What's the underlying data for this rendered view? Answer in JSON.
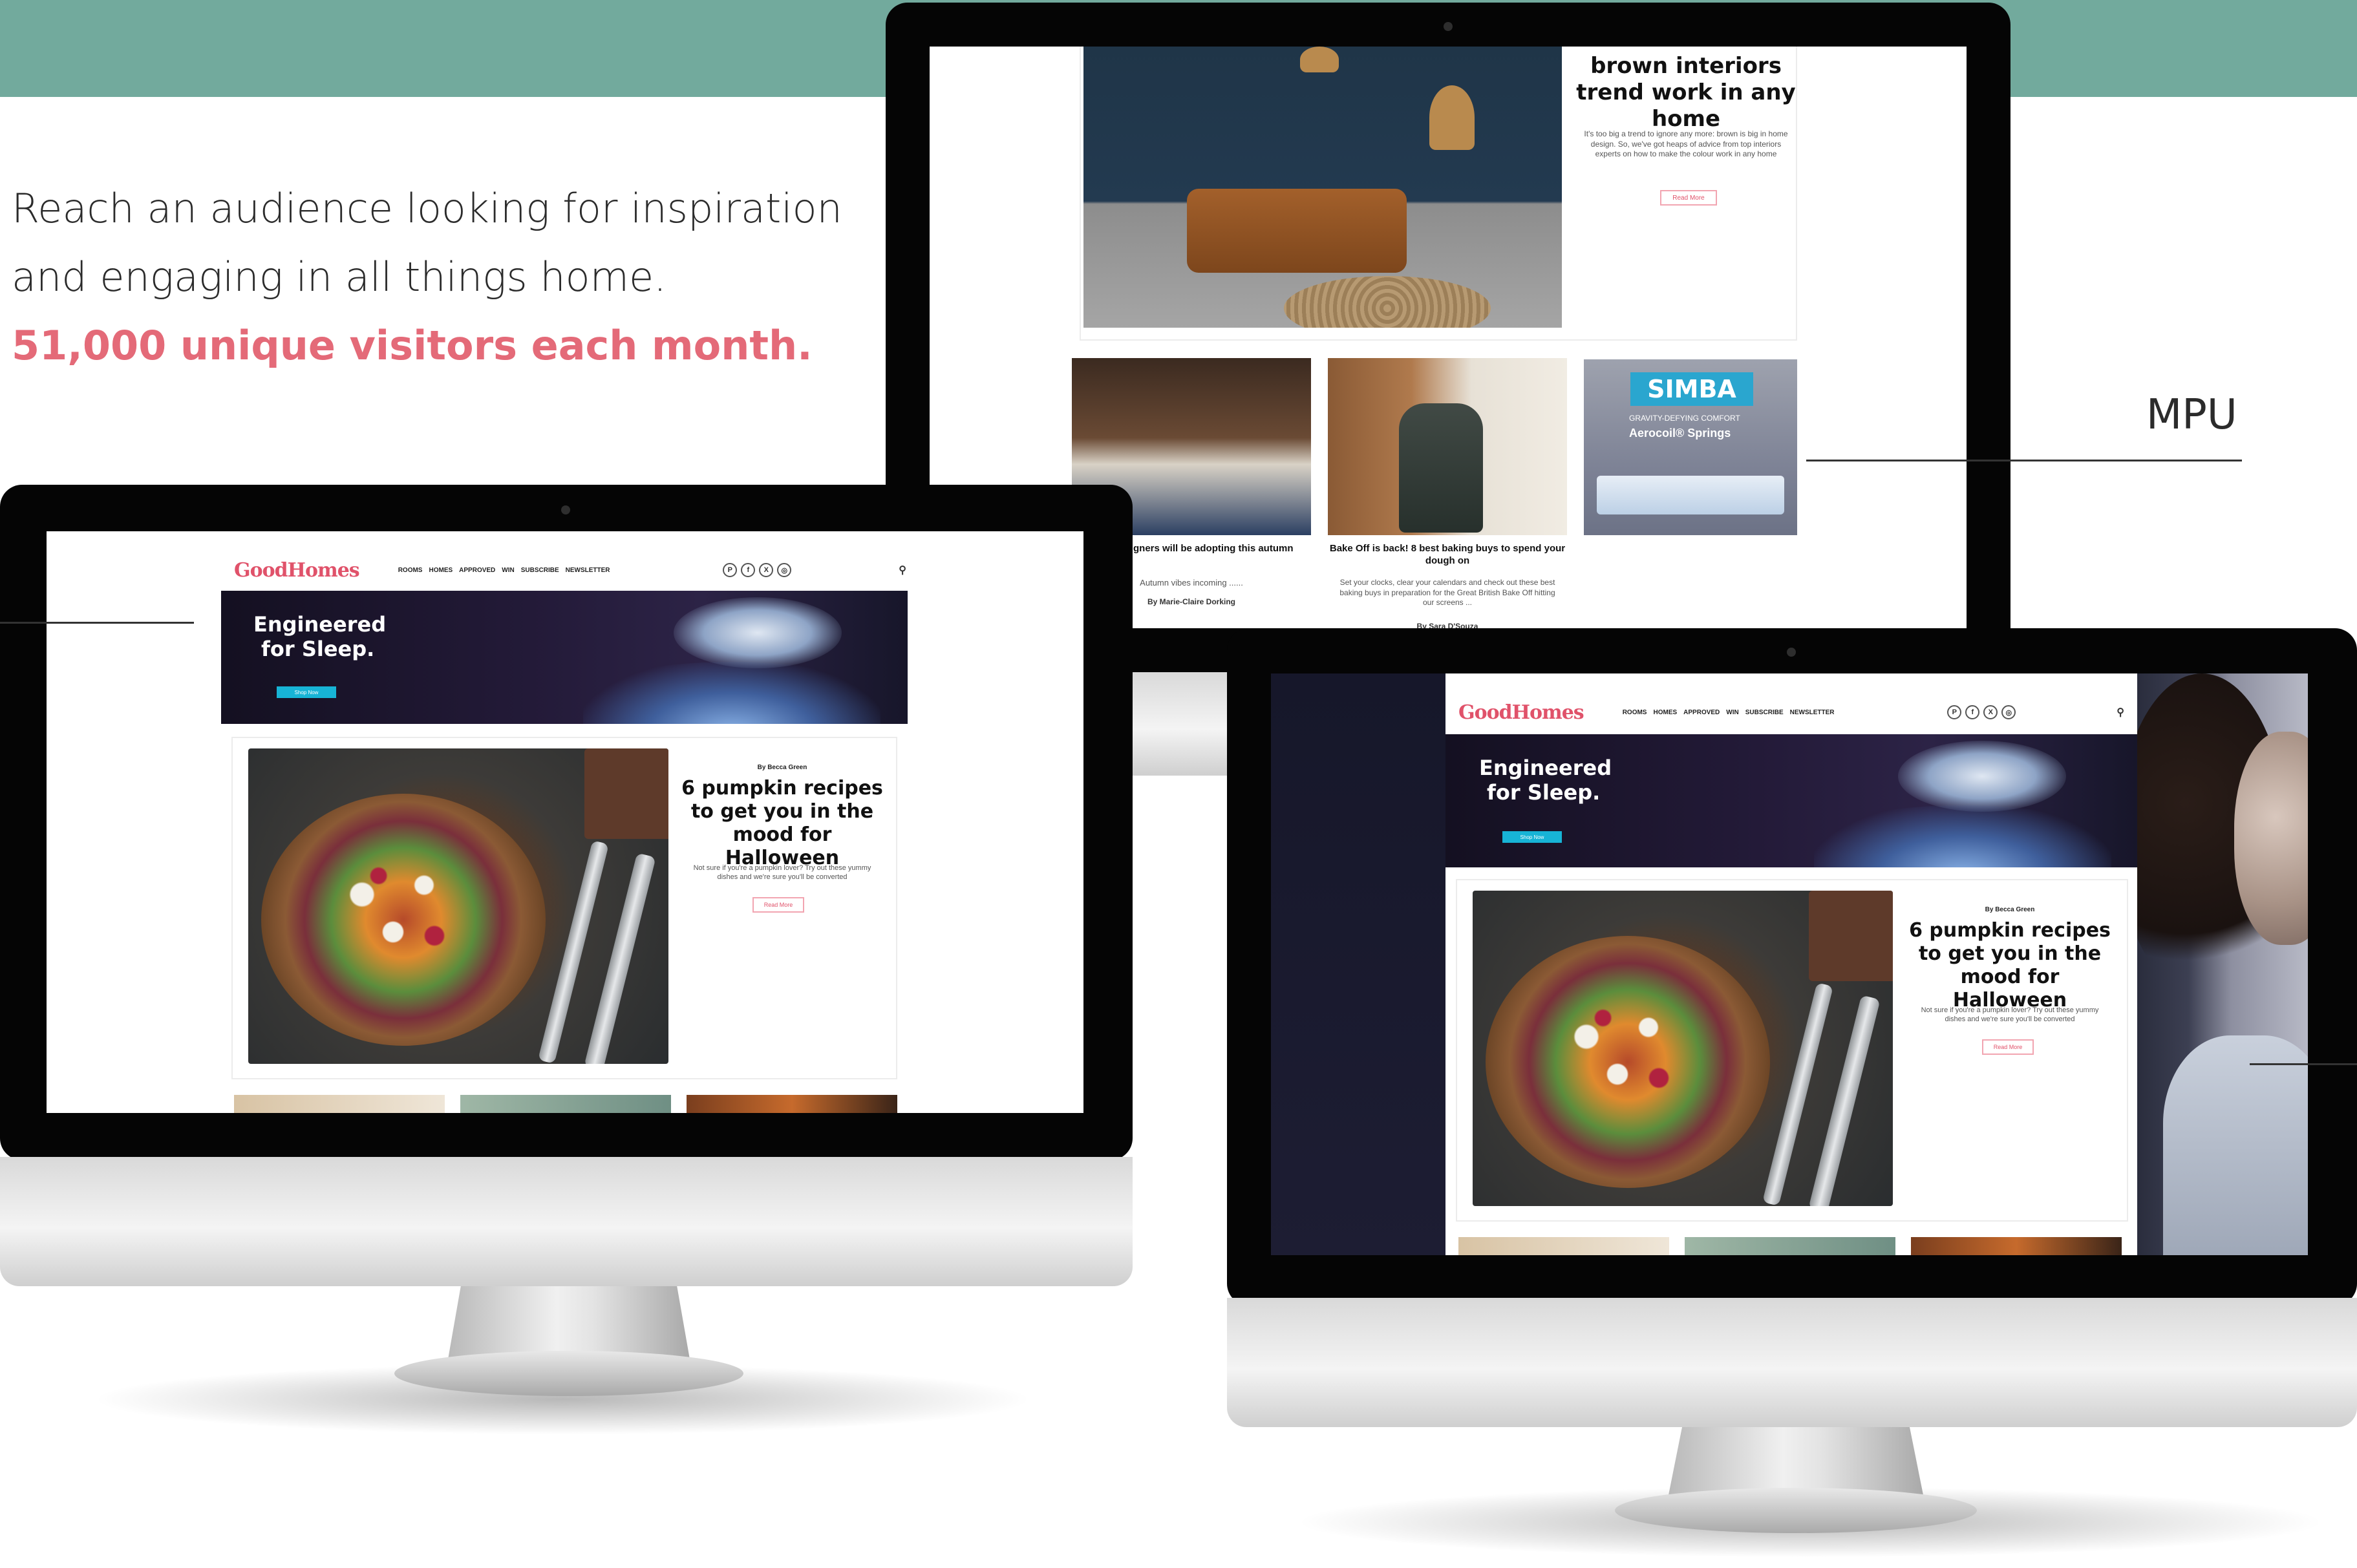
{
  "intro": {
    "line1": "Reach an audience looking for inspiration",
    "line2": "and engaging in all things home.",
    "highlight": "51,000 unique visitors each month."
  },
  "callouts": {
    "mpu": "MPU"
  },
  "site": {
    "logo": "GoodHomes",
    "nav": [
      "ROOMS",
      "HOMES",
      "APPROVED",
      "WIN",
      "SUBSCRIBE",
      "NEWSLETTER"
    ],
    "social_icons": [
      "pinterest-icon",
      "facebook-icon",
      "x-icon",
      "instagram-icon"
    ],
    "social_glyphs": [
      "P",
      "f",
      "X",
      "◎"
    ],
    "search_glyph": "⚲"
  },
  "ad": {
    "title_line1": "Engineered",
    "title_line2": "for Sleep.",
    "button": "Shop Now"
  },
  "feature_article": {
    "byline": "By Becca Green",
    "title": "6 pumpkin recipes to get you in the mood for Halloween",
    "description": "Not sure if you're a pumpkin lover? Try out these yummy dishes and we're sure you'll be converted",
    "read_more": "Read More"
  },
  "back_monitor": {
    "article_title": "brown interiors trend work in any home",
    "article_desc": "It's too big a trend to ignore any more: brown is big in home design. So, we've got heaps of advice from top interiors experts on how to make the colour work in any home",
    "read_more": "Read More",
    "cards": [
      {
        "title": "erior designers will be adopting this autumn",
        "desc": "Autumn vibes incoming ......",
        "byline": "By Marie-Claire Dorking"
      },
      {
        "title": "Bake Off is back! 8 best baking buys to spend your dough on",
        "desc": "Set your clocks, clear your calendars and check out these best baking buys in preparation for the Great British Bake Off hitting our screens ...",
        "byline": "By Sara D'Souza"
      }
    ],
    "simba": {
      "logo": "SIMBA",
      "tagline": "GRAVITY-DEFYING COMFORT",
      "product": "Aerocoil® Springs"
    }
  },
  "colors": {
    "band": "#72aa9d",
    "highlight": "#e46a78",
    "logo": "#e0526a",
    "ad_button": "#17b4d6"
  }
}
